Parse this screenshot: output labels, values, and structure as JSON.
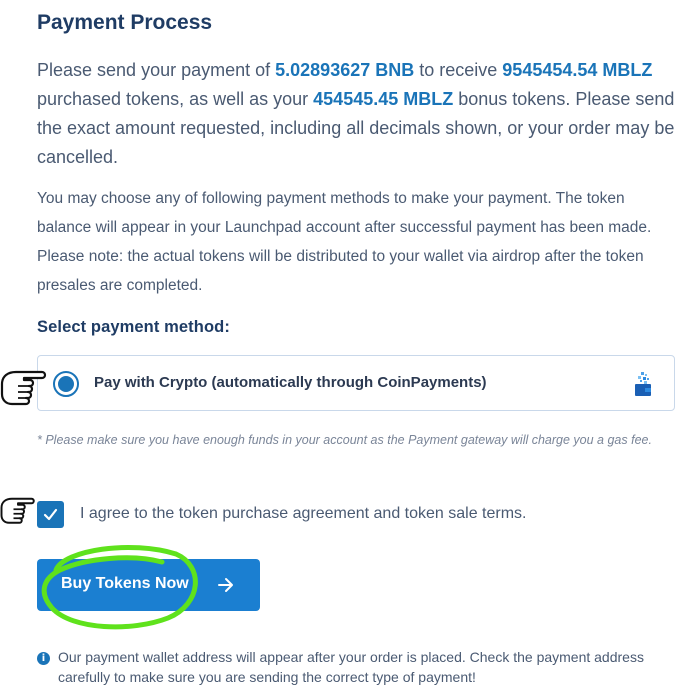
{
  "payment": {
    "title": "Payment Process",
    "intro": {
      "part1": "Please send your payment of ",
      "amount": "5.02893627 BNB",
      "part2": " to receive ",
      "tokens": "9545454.54 MBLZ",
      "part3": " purchased tokens, as well as your ",
      "bonus": "454545.45 MBLZ",
      "part4": " bonus tokens. Please send the exact amount requested, including all decimals shown, or your order may be cancelled."
    },
    "note": "You may choose any of following payment methods to make your payment. The token balance will appear in your Launchpad account after successful payment has been made. Please note: the actual tokens will be distributed to your wallet via airdrop after the token presales are completed.",
    "select_label": "Select payment method:",
    "method": {
      "label": "Pay with Crypto (automatically through CoinPayments)",
      "selected": true,
      "icon": "wallet-icon"
    },
    "gas_note": "* Please make sure you have enough funds in your account as the Payment gateway will charge you a gas fee.",
    "agree": {
      "checked": true,
      "label": "I agree to the token purchase agreement and token sale terms."
    },
    "buy_button": {
      "label": "Buy Tokens Now",
      "icon": "arrow-right-icon"
    },
    "info": "Our payment wallet address will appear after your order is placed. Check the payment address carefully to make sure you are sending the correct type of payment!"
  },
  "colors": {
    "accent": "#1a74b8",
    "button": "#1b7fd1",
    "heading": "#1f3c64",
    "annotation": "#5fe21c"
  }
}
